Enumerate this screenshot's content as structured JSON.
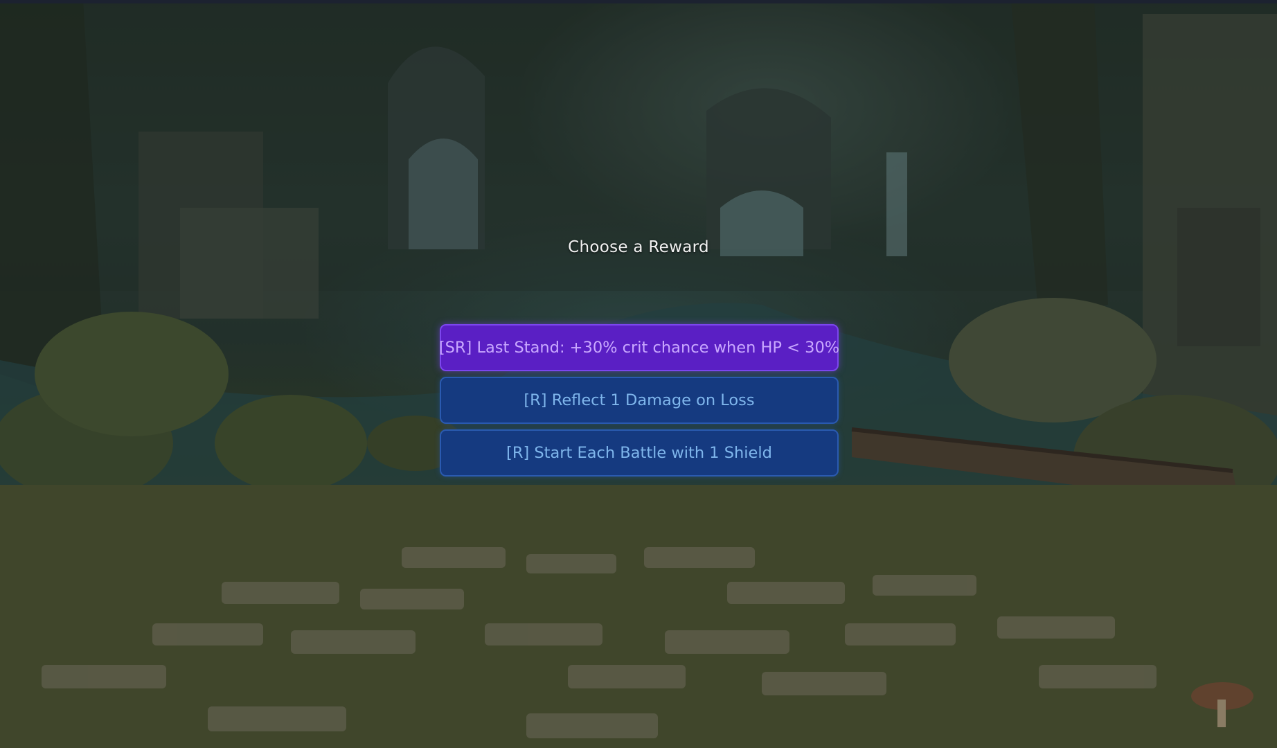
{
  "screen": {
    "title": "Choose a Reward"
  },
  "rewards": [
    {
      "label": "[SR] Last Stand: +30% crit chance when HP < 30%",
      "rarity": "SR",
      "color": "#5a1fc4"
    },
    {
      "label": "[R] Reflect 1 Damage on Loss",
      "rarity": "R",
      "color": "#153a80"
    },
    {
      "label": "[R] Start Each Battle with 1 Shield",
      "rarity": "R",
      "color": "#153a80"
    }
  ]
}
